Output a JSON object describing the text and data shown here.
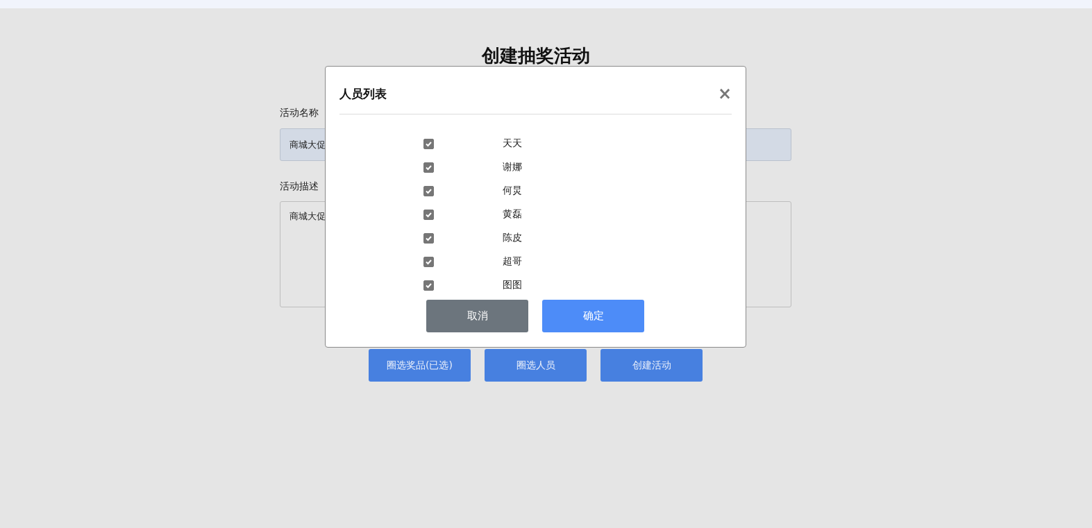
{
  "page": {
    "title": "创建抽奖活动",
    "fields": [
      {
        "kind": "input",
        "label": "活动名称",
        "value": "商城大促"
      },
      {
        "kind": "textarea",
        "label": "活动描述",
        "value": "商城大促"
      }
    ],
    "buttons": [
      "圈选奖品(已选)",
      "圈选人员",
      "创建活动"
    ]
  },
  "dialog": {
    "title": "人员列表",
    "close": "×",
    "people": [
      {
        "name": "天天",
        "checked": true
      },
      {
        "name": "谢娜",
        "checked": true
      },
      {
        "name": "何炅",
        "checked": true
      },
      {
        "name": "黄磊",
        "checked": true
      },
      {
        "name": "陈皮",
        "checked": true
      },
      {
        "name": "超哥",
        "checked": true
      },
      {
        "name": "图图",
        "checked": true
      }
    ],
    "buttons": [
      {
        "label": "取消",
        "kind": "secondary"
      },
      {
        "label": "确定",
        "kind": "primary"
      }
    ]
  }
}
